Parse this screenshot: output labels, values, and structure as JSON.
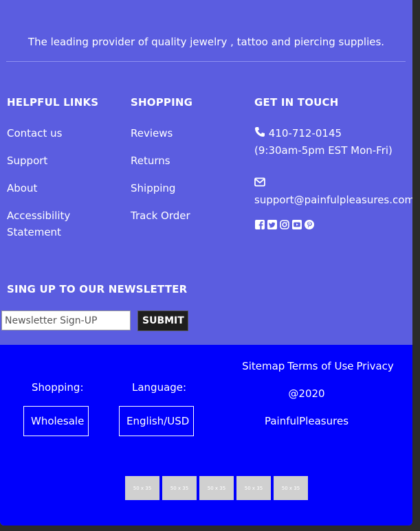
{
  "tagline": "The leading provider of quality jewelry , tattoo and piercing supplies.",
  "helpful_links": {
    "title": "HELPFUL LINKS",
    "items": [
      "Contact us",
      "Support",
      "About",
      "Accessibility Statement"
    ]
  },
  "shopping": {
    "title": "SHOPPING",
    "items": [
      "Reviews",
      "Returns",
      "Shipping",
      "Track Order"
    ]
  },
  "contact": {
    "title": "GET IN TOUCH",
    "phone": "410-712-0145",
    "hours": "(9:30am-5pm EST Mon-Fri)",
    "email": "support@painfulpleasures.com",
    "social_icons": [
      "facebook-icon",
      "twitter-icon",
      "instagram-icon",
      "youtube-icon",
      "pinterest-icon"
    ]
  },
  "newsletter": {
    "title": "SING UP TO OUR NEWSLETTER",
    "placeholder": "Newsletter Sign-UP",
    "submit_label": "SUBMIT"
  },
  "bottom": {
    "shopping_label": "Shopping:",
    "wholesale_label": "Wholesale",
    "language_label": "Language:",
    "language_value": "English/USD",
    "links": [
      "Sitemap",
      "Terms of Use",
      "Privacy"
    ],
    "copyright": "@2020",
    "brand": "PainfulPleasures",
    "payment_placeholders": [
      "50 x 35",
      "50 x 35",
      "50 x 35",
      "50 x 35",
      "50 x 35"
    ]
  },
  "colors": {
    "top_bg": "#5b5de0",
    "bottom_bg": "#0000fc",
    "text": "#ffffff"
  }
}
